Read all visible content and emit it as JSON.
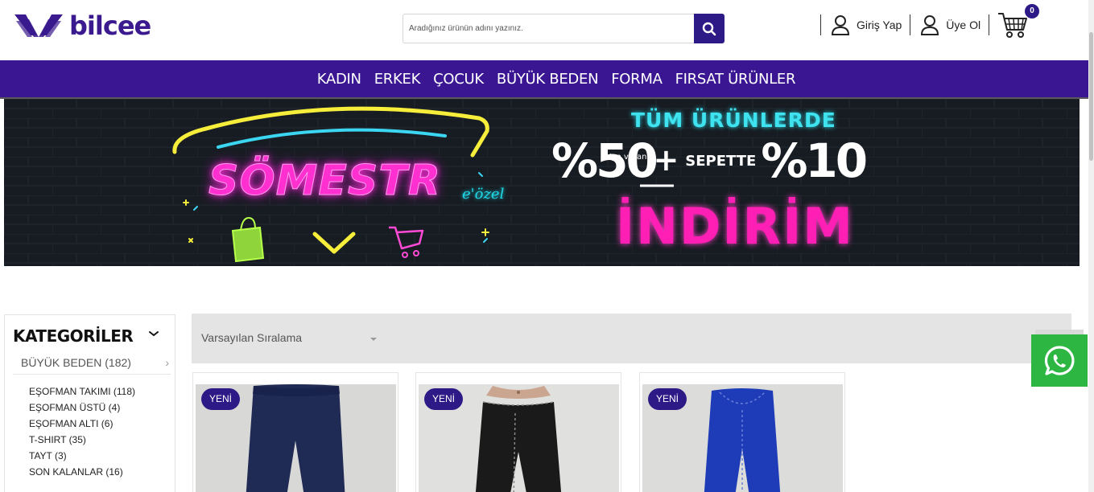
{
  "header": {
    "logo_text": "bilcee",
    "search": {
      "placeholder": "Aradığınız ürünün adını yazınız."
    },
    "login_label": "Giriş Yap",
    "register_label": "Üye Ol",
    "cart_count": "0"
  },
  "nav": {
    "items": [
      "KADIN",
      "ERKEK",
      "ÇOCUK",
      "BÜYÜK BEDEN",
      "FORMA",
      "FIRSAT ÜRÜNLER"
    ]
  },
  "banner": {
    "somestr": "SÖMESTR",
    "ozel": "e'özel",
    "headline": "TÜM ÜRÜNLERDE",
    "pct1": "%50",
    "pct1_suffix": "'ye varan",
    "plus": "+",
    "sepette": "SEPETTE",
    "pct2": "%10",
    "main": "İNDİRİM"
  },
  "sidebar": {
    "title": "KATEGORİLER",
    "main_category": "BÜYÜK BEDEN (182)",
    "subcategories": [
      "EŞOFMAN TAKIMI (118)",
      "EŞOFMAN ÜSTÜ (4)",
      "EŞOFMAN ALTI (6)",
      "T-SHIRT (35)",
      "TAYT (3)",
      "SON KALANLAR (16)"
    ]
  },
  "sort": {
    "selected": "Varsayılan Sıralama"
  },
  "products": [
    {
      "badge": "YENİ",
      "color": "#1f2a55"
    },
    {
      "badge": "YENİ",
      "color": "#1a1a1a"
    },
    {
      "badge": "YENİ",
      "color": "#1e3cb8"
    }
  ],
  "colors": {
    "brand": "#3b1693",
    "accent": "#2e1a86",
    "whatsapp": "#2db742"
  }
}
